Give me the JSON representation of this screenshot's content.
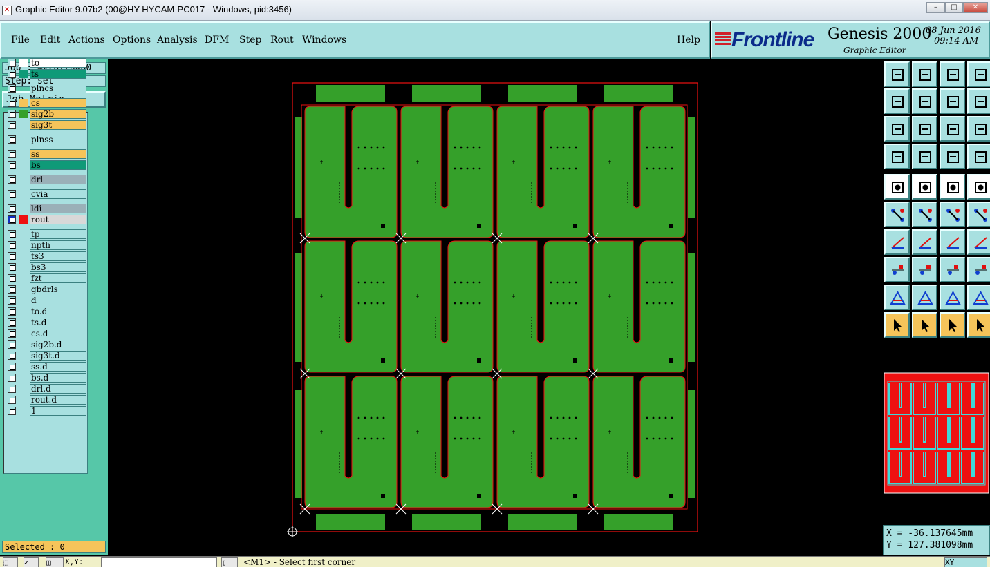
{
  "window": {
    "title": "Graphic Editor 9.07b2 (00@HY-HYCAM-PC017 - Windows, pid:3456)",
    "buttons": [
      "–",
      "□",
      "✕"
    ]
  },
  "menubar": {
    "items": [
      "File",
      "Edit",
      "Actions",
      "Options",
      "Analysis",
      "DFM",
      "Step",
      "Rout",
      "Windows"
    ],
    "help": "Help"
  },
  "logo": {
    "brand": "Frontline",
    "product": "Genesis 2000",
    "subtitle": "Graphic Editor",
    "date": "08 Jun 2016",
    "time": "09:14 AM",
    "brand_color": "#0a2a8a",
    "accent_color": "#d0202a"
  },
  "left": {
    "job": "Job : 4v2g720wa0",
    "step": "Step: set",
    "job_matrix": "Job Matrix ...",
    "selected": "Selected : 0"
  },
  "layers": [
    {
      "name": "to",
      "color": "#ffffff",
      "bg": "#ffffff"
    },
    {
      "name": "ts",
      "color": "#0f9a78",
      "bg": "#0f9a78"
    },
    {
      "name": "plncs",
      "color": "",
      "bg": "#a8e0e0"
    },
    {
      "name": "cs",
      "color": "#f5c45a",
      "bg": "#f5c45a"
    },
    {
      "name": "sig2b",
      "color": "#35a02a",
      "bg": "#f5c45a"
    },
    {
      "name": "sig3t",
      "color": "",
      "bg": "#f5c45a"
    },
    {
      "name": "plnss",
      "color": "",
      "bg": "#a8e0e0"
    },
    {
      "name": "ss",
      "color": "",
      "bg": "#f5c45a"
    },
    {
      "name": "bs",
      "color": "",
      "bg": "#0f9a78"
    },
    {
      "name": "drl",
      "color": "",
      "bg": "#9ab0b8"
    },
    {
      "name": "cvia",
      "color": "",
      "bg": "#a8e0e0"
    },
    {
      "name": "ldi",
      "color": "",
      "bg": "#9ab0b8"
    },
    {
      "name": "rout",
      "color": "#ee1111",
      "bg": "#d8d8d8",
      "active": true
    },
    {
      "name": "tp",
      "color": "",
      "bg": "#a8e0e0"
    },
    {
      "name": "npth",
      "color": "",
      "bg": "#a8e0e0"
    },
    {
      "name": "ts3",
      "color": "",
      "bg": "#a8e0e0"
    },
    {
      "name": "bs3",
      "color": "",
      "bg": "#a8e0e0"
    },
    {
      "name": "fzt",
      "color": "",
      "bg": "#a8e0e0"
    },
    {
      "name": "gbdrls",
      "color": "",
      "bg": "#a8e0e0"
    },
    {
      "name": "d",
      "color": "",
      "bg": "#a8e0e0"
    },
    {
      "name": "to.d",
      "color": "",
      "bg": "#a8e0e0"
    },
    {
      "name": "ts.d",
      "color": "",
      "bg": "#a8e0e0"
    },
    {
      "name": "cs.d",
      "color": "",
      "bg": "#a8e0e0"
    },
    {
      "name": "sig2b.d",
      "color": "",
      "bg": "#a8e0e0"
    },
    {
      "name": "sig3t.d",
      "color": "",
      "bg": "#a8e0e0"
    },
    {
      "name": "ss.d",
      "color": "",
      "bg": "#a8e0e0"
    },
    {
      "name": "bs.d",
      "color": "",
      "bg": "#a8e0e0"
    },
    {
      "name": "drl.d",
      "color": "",
      "bg": "#a8e0e0"
    },
    {
      "name": "rout.d",
      "color": "",
      "bg": "#a8e0e0"
    },
    {
      "name": "1",
      "color": "",
      "bg": "#a8e0e0"
    }
  ],
  "panel": {
    "board_color": "#35a02a",
    "outline_color": "#ee1111",
    "columns": 4,
    "rows": 3
  },
  "coords": {
    "x": "X = -36.137645mm",
    "y": "Y = 127.381098mm"
  },
  "status": {
    "xy": "X,Y:",
    "prompt": "<M1> - Select first corner"
  }
}
